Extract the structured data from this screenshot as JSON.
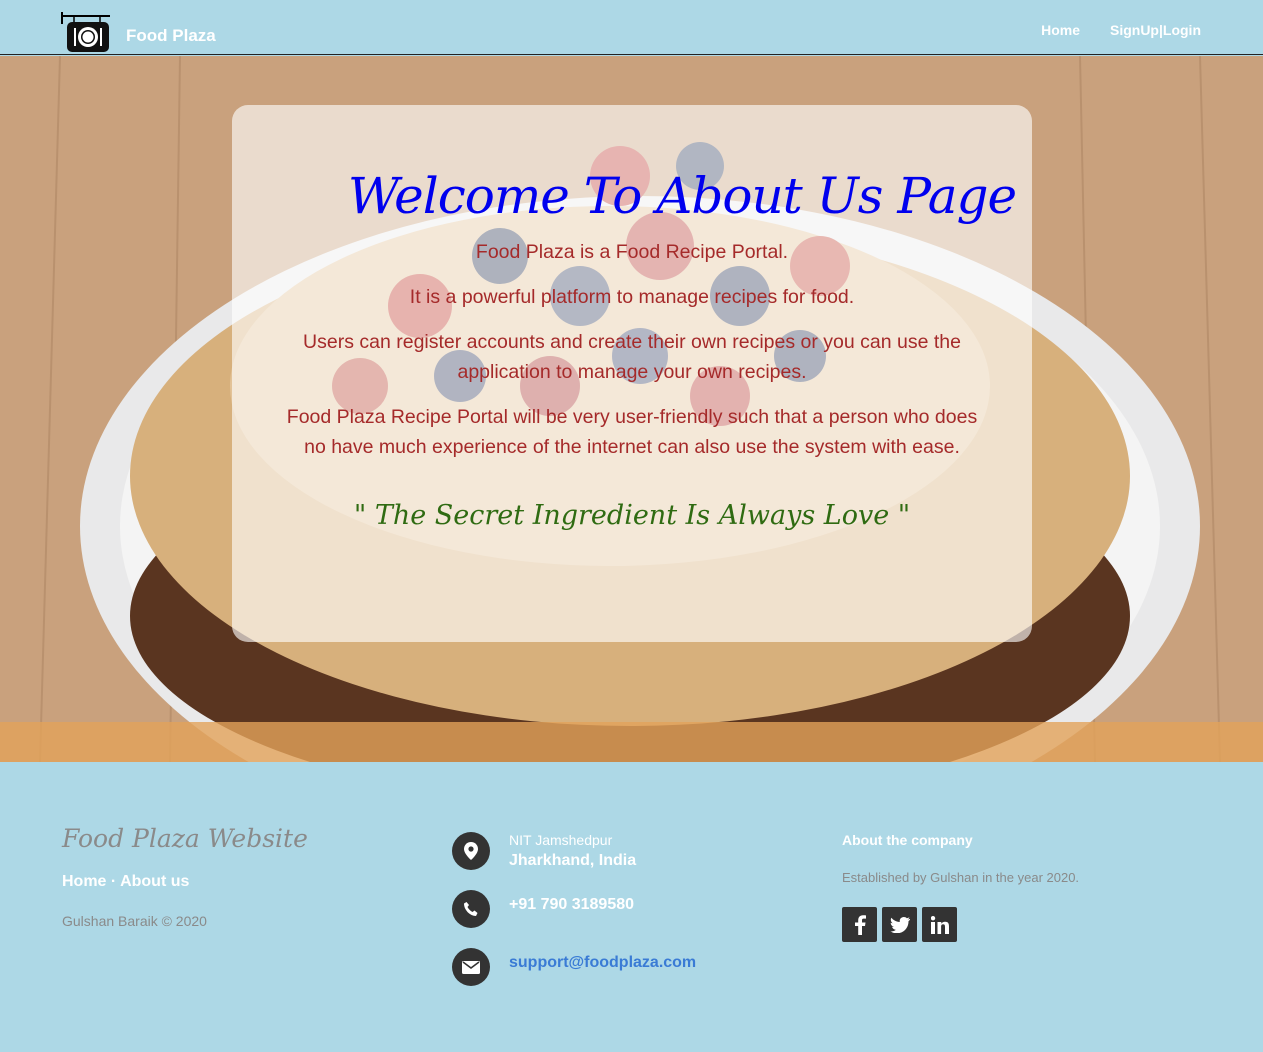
{
  "navbar": {
    "brand": "Food Plaza",
    "links": [
      "Home",
      "SignUp|Login"
    ]
  },
  "hero": {
    "title": "Welcome To About Us Page",
    "paragraphs": [
      "Food Plaza is a Food Recipe Portal.",
      "It is a powerful platform to manage recipes for food.",
      "Users can register accounts and create their own recipes or you can use the application to manage your own recipes.",
      "Food Plaza Recipe Portal will be very user-friendly such that a person who does no have much experience of the internet can also use the system with ease."
    ],
    "quote": "\" The Secret Ingredient Is Always Love \""
  },
  "footer": {
    "title": "Food Plaza Website",
    "links": {
      "home": "Home",
      "sep": " · ",
      "about": "About us"
    },
    "copyright": "Gulshan Baraik © 2020",
    "contact": {
      "city": "NIT Jamshedpur",
      "state": "Jharkhand, India",
      "phone": "+91 790 3189580",
      "email": "support@foodplaza.com"
    },
    "about": {
      "heading": "About the company",
      "text": "Established by Gulshan in the year 2020."
    },
    "socials": [
      "facebook-icon",
      "twitter-icon",
      "linkedin-icon"
    ]
  },
  "colors": {
    "nav_bg": "#add8e6",
    "title_blue": "#0000ee",
    "text_brown": "#a52a2a",
    "quote_green": "#2f6b12",
    "icon_dark": "#333333"
  }
}
